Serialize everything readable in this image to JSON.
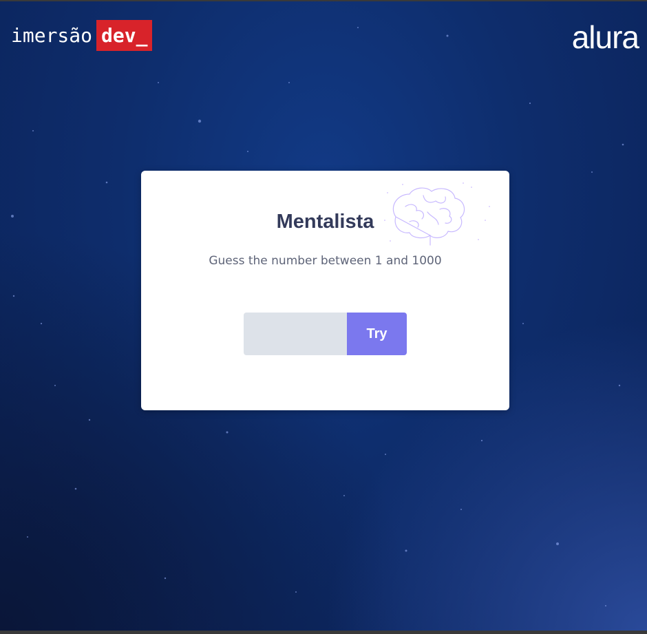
{
  "header": {
    "brand_word": "imersão",
    "brand_tag": "dev_",
    "partner_logo": "alura",
    "brand_tag_color": "#d8232a"
  },
  "card": {
    "title": "Mentalista",
    "subtitle": "Guess the number between 1 and 1000",
    "illustration_icon": "brain-icon",
    "input": {
      "value": "",
      "placeholder": ""
    },
    "try_label": "Try",
    "try_color": "#7b78ee"
  },
  "background_color": "#0e2d6c"
}
